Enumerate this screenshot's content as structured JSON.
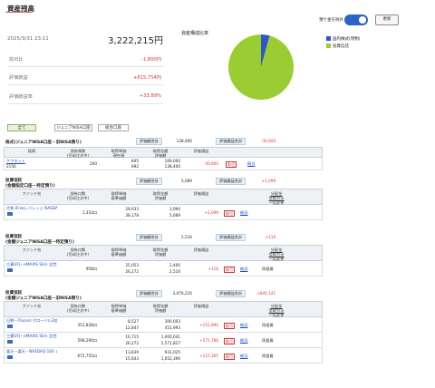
{
  "title": "資産残高",
  "summary": {
    "date": "2025/3/31 23:11",
    "total": "3,222,215円",
    "rows": [
      {
        "label": "前日比",
        "value": "-1,800円",
        "cls": "neg"
      },
      {
        "label": "評価損益",
        "value": "+815,754円",
        "cls": "pos"
      },
      {
        "label": "評価損益率",
        "value": "+33.89%",
        "cls": "pos"
      }
    ]
  },
  "pie": {
    "title": "資産構成比率",
    "legend": [
      {
        "label": "国内株式(現物)",
        "color": "#2f56c4",
        "value": 4.3
      },
      {
        "label": "投資信託",
        "color": "#9acd32",
        "value": 95.7
      }
    ]
  },
  "controls": {
    "toggle_label": "預り金を除外",
    "refresh_label": "更新"
  },
  "tabs": [
    "全て",
    "ジュニアNISA口座",
    "総合口座"
  ],
  "stock": {
    "head": "株式(ジュニアNISA口座・旧NISA預り)",
    "eval_label": "評価額合計",
    "eval_value": "138,400",
    "pl_label": "評価損益合計",
    "pl_value": "-30,600",
    "cols": [
      "銘柄",
      "保有株数\n(売却注文中)",
      "取得単価\n現在値",
      "取得金額\n評価額",
      "評価損益",
      "",
      ""
    ],
    "rows": [
      {
        "name": "ケアネット",
        "code": "2150",
        "qty": "200",
        "a": "845",
        "b": "692",
        "c": "169,000",
        "d": "138,400",
        "pl": "-30,600",
        "act1": "取引",
        "act2": "概況"
      }
    ]
  },
  "funds": [
    {
      "head1": "投資信託",
      "head2": "(金額指定口座－特定預り)",
      "eval_label": "評価額合計",
      "eval_value": "5,089",
      "pl_label": "評価損益合計",
      "pl_value": "+1,099",
      "rows": [
        {
          "name": "大和-iFreeレバレッジ NASDAQ100",
          "qty": "1,333口",
          "a": "29,933",
          "b": "38,178",
          "c": "3,990",
          "d": "5,089",
          "pl": "+1,099",
          "act1": "取引",
          "act2": "概況"
        }
      ]
    },
    {
      "head1": "投資信託",
      "head2": "(金額ジュニアNISA口座－特定預り)",
      "eval_label": "評価額合計",
      "eval_value": "2,516",
      "pl_label": "評価損益合計",
      "pl_value": "+116",
      "rows": [
        {
          "name": "三菱UFJ－eMAXIS Slim 全世界株式(オール・カントリー)",
          "qty": "958口",
          "a": "25,053",
          "b": "26,272",
          "c": "2,400",
          "d": "2,516",
          "pl": "+116",
          "act1": "取引",
          "act2": "概況",
          "act3": "再投資"
        }
      ]
    },
    {
      "head1": "投資信託",
      "head2": "(金額ジュニアNISA口座－旧NISA預り)",
      "eval_label": "評価額合計",
      "eval_value": "3,076,210",
      "pl_label": "評価損益合計",
      "pl_value": "+845,141",
      "rows": [
        {
          "name": "日興－Tracers グローバル3倍株(分散)リボン(ト)",
          "qty": "351,828口",
          "a": "8,527",
          "b": "12,847",
          "c": "300,003",
          "d": "451,993",
          "pl": "+151,990",
          "act1": "取引",
          "act2": "概況",
          "act3": "再投資"
        },
        {
          "name": "三菱UFJ－eMAXIS Slim 全世界株式(オール・カントリー)",
          "qty": "598,290口",
          "a": "16,715",
          "b": "26,272",
          "c": "1,000,041",
          "d": "1,571,827",
          "pl": "+571,786",
          "act1": "取引",
          "act2": "概況",
          "act3": "再投資"
        },
        {
          "name": "楽天－楽天・NASDAQ-100 レバレッジ・ファンド",
          "qty": "672,755口",
          "a": "13,839",
          "b": "15,643",
          "c": "931,025",
          "d": "1,052,390",
          "pl": "+121,365",
          "act1": "取引",
          "act2": "概況",
          "act3": "再投資"
        }
      ]
    }
  ],
  "fund_cols": [
    "ファンド名",
    "保有口数\n(売却注文中)",
    "取得単価\n基準価額",
    "取得金額\n評価額",
    "評価損益",
    "",
    "分配金\n受取方法\n一括変更"
  ]
}
